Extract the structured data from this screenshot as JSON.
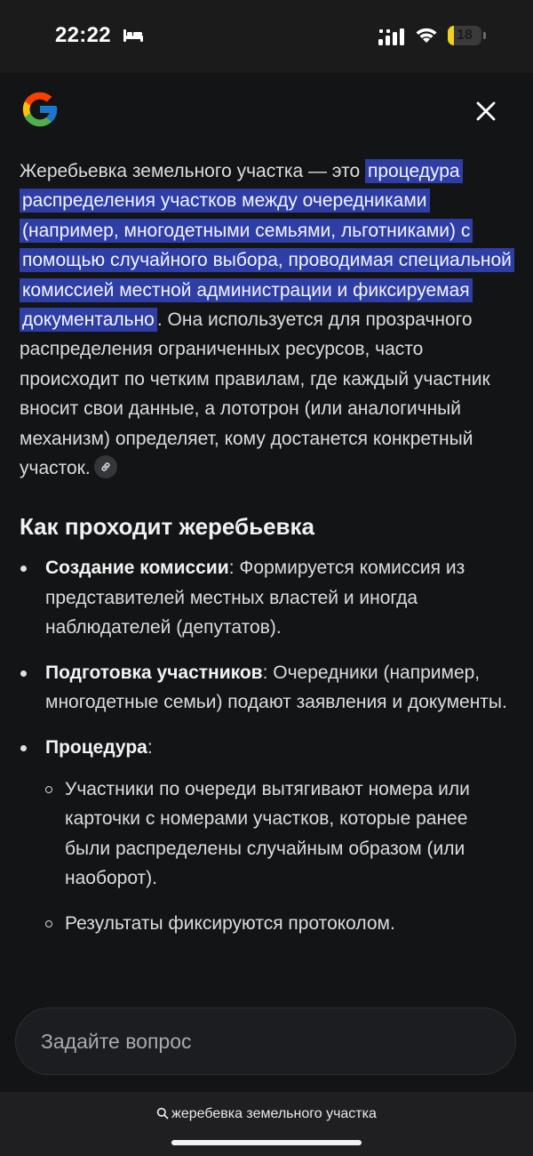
{
  "status_bar": {
    "time": "22:22",
    "battery_level": "18",
    "battery_fraction": 0.18,
    "battery_color": "#f3d21d",
    "icons": [
      "bed-icon",
      "cellular-signal-icon",
      "wifi-icon",
      "battery-icon"
    ]
  },
  "header": {
    "logo": "google-g-logo",
    "close_icon": "close-icon"
  },
  "answer": {
    "intro_plain": "Жеребьевка земельного участка — это ",
    "intro_highlight": "процедура распределения участков между очередниками (например, многодетными семьями, льготниками) с помощью случайного выбора, проводимая специальной комиссией местной администрации и фиксируемая документально",
    "intro_rest": ". Она используется для прозрачного распределения ограниченных ресурсов, часто происходит по четким правилам, где каждый участник вносит свои данные, а лототрон (или аналогичный механизм) определяет, кому достанется конкретный участок.",
    "highlight_color": "#2f3ea5",
    "link_icon": "link-icon"
  },
  "section": {
    "title": "Как проходит жеребьевка",
    "items": [
      {
        "bold": "Создание комиссии",
        "text": ": Формируется комиссия из представителей местных властей и иногда наблюдателей (депутатов)."
      },
      {
        "bold": "Подготовка участников",
        "text": ": Очередники (например, многодетные семьи) подают заявления и документы."
      },
      {
        "bold": "Процедура",
        "text": ":",
        "sub": [
          "Участники по очереди вытягивают номера или карточки с номерами участков, которые ранее были распределены случайным образом (или наоборот).",
          "Результаты фиксируются протоколом."
        ]
      }
    ]
  },
  "ask": {
    "placeholder": "Задайте вопрос"
  },
  "bottom": {
    "query": "жеребевка земельного участка",
    "search_icon": "search-icon"
  }
}
